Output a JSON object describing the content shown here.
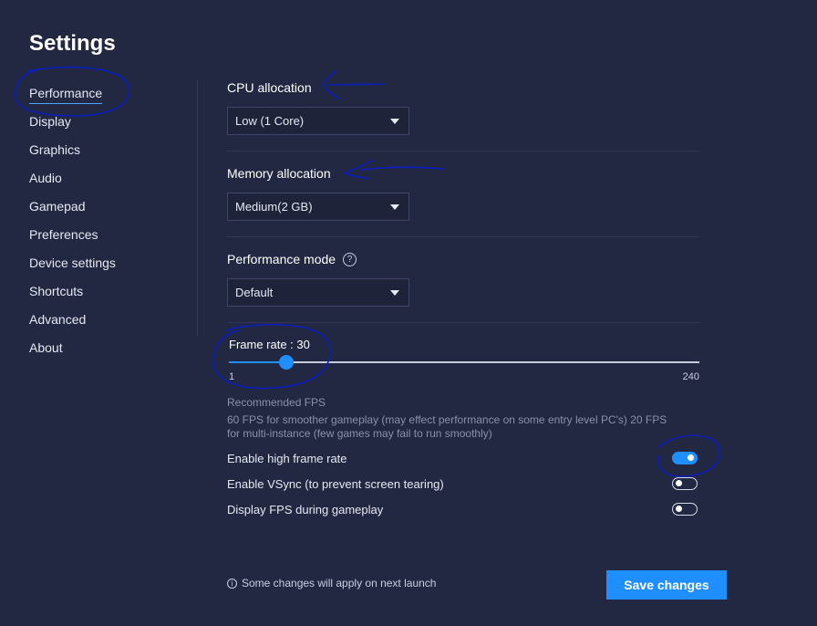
{
  "header": {
    "title": "Settings"
  },
  "sidebar": {
    "items": [
      {
        "label": "Performance",
        "active": true
      },
      {
        "label": "Display"
      },
      {
        "label": "Graphics"
      },
      {
        "label": "Audio"
      },
      {
        "label": "Gamepad"
      },
      {
        "label": "Preferences"
      },
      {
        "label": "Device settings"
      },
      {
        "label": "Shortcuts"
      },
      {
        "label": "Advanced"
      },
      {
        "label": "About"
      }
    ]
  },
  "performance": {
    "cpu": {
      "label": "CPU allocation",
      "value": "Low (1 Core)"
    },
    "memory": {
      "label": "Memory allocation",
      "value": "Medium(2 GB)"
    },
    "mode": {
      "label": "Performance mode",
      "value": "Default",
      "help_glyph": "?"
    },
    "frame_rate": {
      "label": "Frame rate : 30",
      "value": 30,
      "min": 1,
      "max": 240,
      "min_label": "1",
      "max_label": "240"
    },
    "recommended_title": "Recommended FPS",
    "recommended_line1": "60 FPS for smoother gameplay (may effect performance on some entry level PC's) 20 FPS",
    "recommended_line2": "for multi-instance (few games may fail to run smoothly)",
    "toggles": [
      {
        "label": "Enable high frame rate",
        "on": true
      },
      {
        "label": "Enable VSync (to prevent screen tearing)",
        "on": false
      },
      {
        "label": "Display FPS during gameplay",
        "on": false
      }
    ]
  },
  "footer": {
    "info_glyph": "i",
    "note": "Some changes will apply on next launch",
    "save_label": "Save changes"
  },
  "colors": {
    "background": "#232842",
    "accent": "#1f8fff",
    "annotation": "#0a1fbd"
  },
  "icons": {
    "dropdown": "caret-down-icon",
    "help": "question-circle-icon",
    "info": "info-circle-icon"
  }
}
